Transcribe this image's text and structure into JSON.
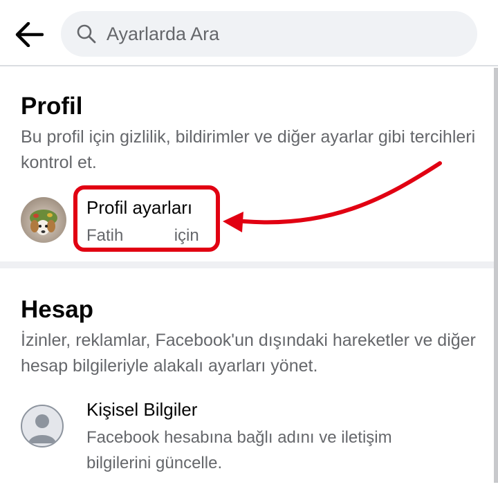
{
  "header": {
    "back_icon": "arrow-left-icon",
    "search_placeholder": "Ayarlarda Ara",
    "search_icon": "search-icon"
  },
  "profile_section": {
    "title": "Profil",
    "description": "Bu profil için gizlilik, bildirimler ve diğer ayarlar gibi tercihleri kontrol et.",
    "item": {
      "title": "Profil ayarları",
      "subtitle_name": "Fatih",
      "subtitle_suffix": "için",
      "avatar": "profile-photo-avatar"
    }
  },
  "account_section": {
    "title": "Hesap",
    "description": "İzinler, reklamlar, Facebook'un dışındaki hareketler ve diğer hesap bilgileriyle alakalı ayarları yönet.",
    "item": {
      "title": "Kişisel Bilgiler",
      "subtitle": "Facebook hesabına bağlı adını ve iletişim bilgilerini güncelle.",
      "avatar": "default-user-avatar"
    }
  },
  "annotation": {
    "color": "#e10012"
  }
}
